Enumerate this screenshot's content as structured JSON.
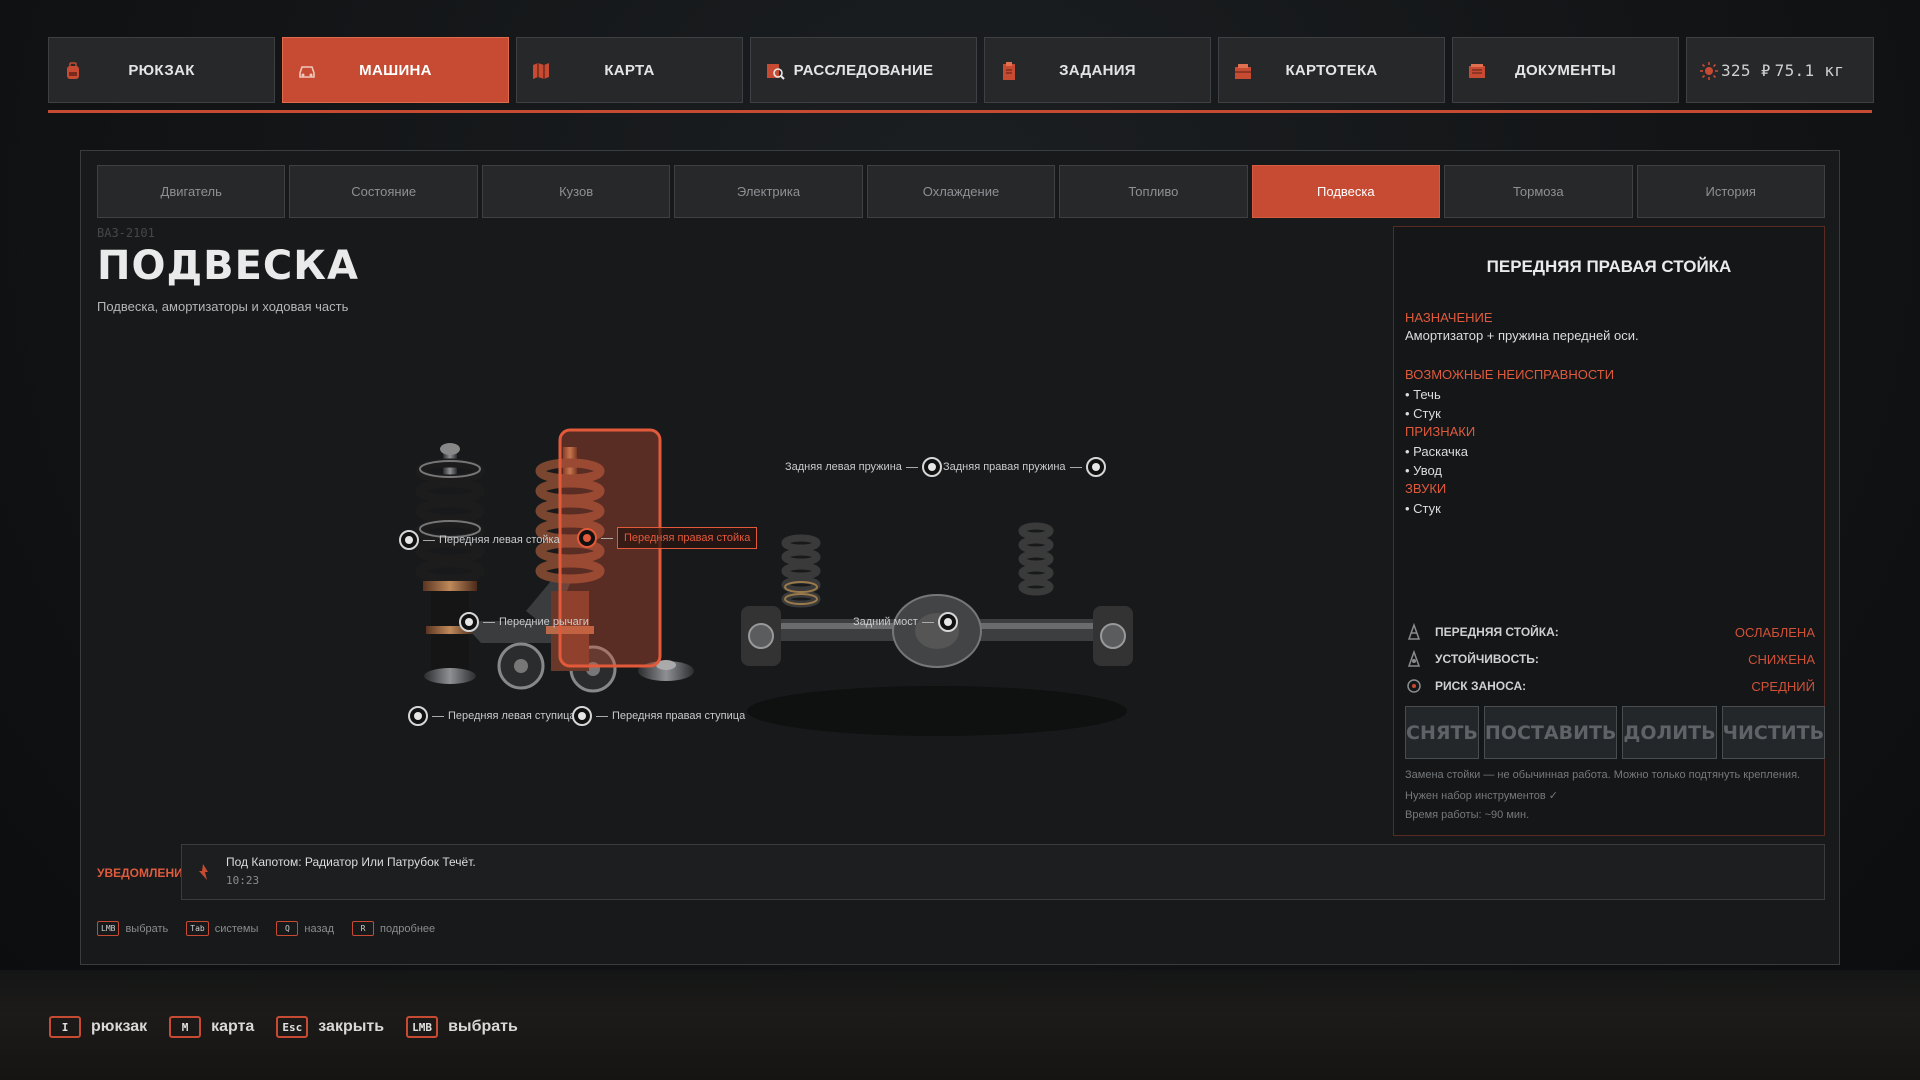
{
  "top_tabs": [
    {
      "label": "РЮКЗАК",
      "icon": "backpack-icon"
    },
    {
      "label": "МАШИНА",
      "icon": "car-icon",
      "active": true
    },
    {
      "label": "КАРТА",
      "icon": "map-icon"
    },
    {
      "label": "РАССЛЕДОВАНИЕ",
      "icon": "investigation-icon"
    },
    {
      "label": "ЗАДАНИЯ",
      "icon": "clipboard-icon"
    },
    {
      "label": "КАРТОТЕКА",
      "icon": "card-file-icon"
    },
    {
      "label": "ДОКУМЕНТЫ",
      "icon": "documents-icon"
    }
  ],
  "stats": {
    "money": "325 ₽",
    "weight": "75.1 кг"
  },
  "sub_tabs": [
    "Двигатель",
    "Состояние",
    "Кузов",
    "Электрика",
    "Охлаждение",
    "Топливо",
    "Подвеска",
    "Тормоза",
    "История"
  ],
  "active_sub_tab": "Подвеска",
  "car_model": "ВАЗ-2101",
  "page": {
    "title": "ПОДВЕСКА",
    "subtitle": "Подвеска, амортизаторы и ходовая часть"
  },
  "hotspots": {
    "front_left_strut": "Передняя левая стойка",
    "front_right_strut": "Передняя правая стойка",
    "front_arms": "Передние рычаги",
    "front_left_hub": "Передняя левая ступица",
    "front_right_hub": "Передняя правая ступица",
    "rear_left_spring": "Задняя левая пружина",
    "rear_right_spring": "Задняя правая пружина",
    "rear_axle": "Задний мост"
  },
  "info": {
    "title": "ПЕРЕДНЯЯ ПРАВАЯ СТОЙКА",
    "purpose_title": "НАЗНАЧЕНИЕ",
    "purpose": "Амортизатор + пружина передней оси.",
    "faults_title": "ВОЗМОЖНЫЕ НЕИСПРАВНОСТИ",
    "faults": [
      "• Течь",
      "• Стук"
    ],
    "signs_title": "ПРИЗНАКИ",
    "signs": [
      "• Раскачка",
      "• Увод"
    ],
    "sounds_title": "ЗВУКИ",
    "sounds": [
      "• Стук"
    ],
    "stats": [
      {
        "name": "ПЕРЕДНЯЯ СТОЙКА:",
        "value": "ОСЛАБЛЕНА",
        "icon": "strut-icon"
      },
      {
        "name": "УСТОЙЧИВОСТЬ:",
        "value": "СНИЖЕНА",
        "icon": "stability-icon"
      },
      {
        "name": "РИСК ЗАНОСА:",
        "value": "СРЕДНИЙ",
        "icon": "skid-risk-icon"
      }
    ],
    "actions": [
      "СНЯТЬ",
      "ПОСТАВИТЬ",
      "ДОЛИТЬ",
      "ЧИСТИТЬ"
    ],
    "notes": [
      "Замена стойки — не обычинная работа. Можно только подтянуть крепления.",
      "Нужен набор инструментов ✓",
      "Время работы: ~90 мин."
    ]
  },
  "notifications": {
    "label": "УВЕДОМЛЕНИЯ",
    "text": "Под Капотом: Радиатор Или Патрубок Течёт.",
    "time": "10:23"
  },
  "panel_hints": [
    {
      "key": "LMB",
      "label": "выбрать"
    },
    {
      "key": "Tab",
      "label": "системы"
    },
    {
      "key": "Q",
      "label": "назад"
    },
    {
      "key": "R",
      "label": "подробнее"
    }
  ],
  "bottom_hints": [
    {
      "key": "I",
      "label": "рюкзак"
    },
    {
      "key": "M",
      "label": "карта"
    },
    {
      "key": "Esc",
      "label": "закрыть"
    },
    {
      "key": "LMB",
      "label": "выбрать"
    }
  ],
  "colors": {
    "accent": "#c74a32",
    "warning": "#e05a3d"
  }
}
